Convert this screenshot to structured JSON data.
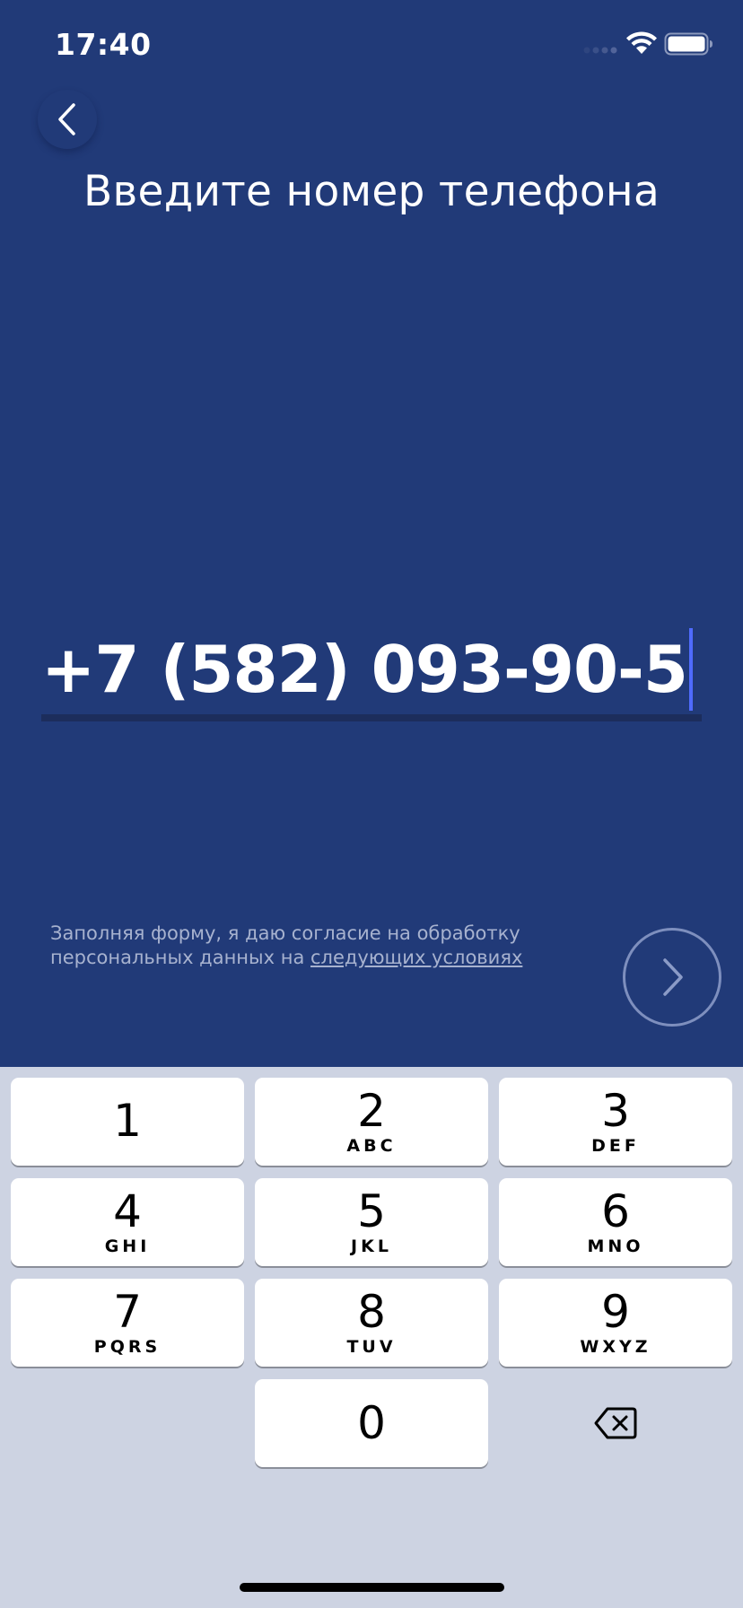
{
  "status_bar": {
    "time": "17:40",
    "icons": [
      "cellular-signal-icon",
      "wifi-icon",
      "battery-icon"
    ]
  },
  "header": {
    "back_icon": "chevron-left-icon",
    "title": "Введите номер телефона"
  },
  "phone_field": {
    "value": "+7 (582) 093-90-5"
  },
  "consent": {
    "text": "Заполняя форму, я даю согласие на обработку персональных данных на ",
    "link_text": "следующих условиях"
  },
  "next_button": {
    "icon": "chevron-right-icon"
  },
  "keyboard": {
    "keys": [
      {
        "digit": "1",
        "letters": ""
      },
      {
        "digit": "2",
        "letters": "ABC"
      },
      {
        "digit": "3",
        "letters": "DEF"
      },
      {
        "digit": "4",
        "letters": "GHI"
      },
      {
        "digit": "5",
        "letters": "JKL"
      },
      {
        "digit": "6",
        "letters": "MNO"
      },
      {
        "digit": "7",
        "letters": "PQRS"
      },
      {
        "digit": "8",
        "letters": "TUV"
      },
      {
        "digit": "9",
        "letters": "WXYZ"
      },
      {
        "digit": "0",
        "letters": ""
      }
    ],
    "delete_icon": "backspace-icon"
  },
  "colors": {
    "background": "#213A78",
    "keyboard_background": "#CDD3E2",
    "cursor": "#4F6BFF",
    "consent_text": "#A7B2CF"
  }
}
